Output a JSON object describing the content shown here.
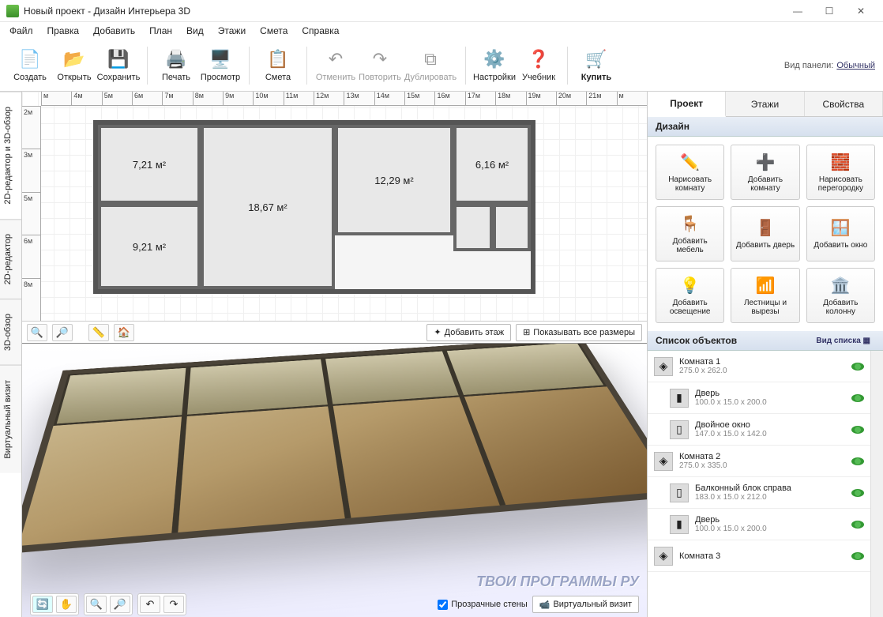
{
  "window": {
    "title": "Новый проект - Дизайн Интерьера 3D"
  },
  "menu": [
    "Файл",
    "Правка",
    "Добавить",
    "План",
    "Вид",
    "Этажи",
    "Смета",
    "Справка"
  ],
  "toolbar": {
    "create": "Создать",
    "open": "Открыть",
    "save": "Сохранить",
    "print": "Печать",
    "preview": "Просмотр",
    "estimate": "Смета",
    "undo": "Отменить",
    "redo": "Повторить",
    "duplicate": "Дублировать",
    "settings": "Настройки",
    "tutorial": "Учебник",
    "buy": "Купить",
    "panel_label": "Вид панели:",
    "panel_mode": "Обычный"
  },
  "sidetabs": {
    "t1": "2D-редактор и 3D-обзор",
    "t2": "2D-редактор",
    "t3": "3D-обзор",
    "t4": "Виртуальный визит"
  },
  "ruler_h": [
    "м",
    "4м",
    "5м",
    "6м",
    "7м",
    "8м",
    "9м",
    "10м",
    "11м",
    "12м",
    "13м",
    "14м",
    "15м",
    "16м",
    "17м",
    "18м",
    "19м",
    "20м",
    "21м",
    "м"
  ],
  "ruler_v": [
    "2м",
    "3м",
    "5м",
    "6м",
    "8м"
  ],
  "rooms": {
    "r1": "7,21 м²",
    "r2": "18,67 м²",
    "r3": "12,29 м²",
    "r4": "6,16 м²",
    "r5": "9,21 м²"
  },
  "canvas2d": {
    "add_floor": "Добавить этаж",
    "show_dims": "Показывать все размеры"
  },
  "canvas3d": {
    "transparent": "Прозрачные стены",
    "camera": "Виртуальный визит"
  },
  "rtabs": {
    "project": "Проект",
    "floors": "Этажи",
    "props": "Свойства"
  },
  "design": {
    "header": "Дизайн",
    "draw_room": "Нарисовать комнату",
    "add_room": "Добавить комнату",
    "draw_partition": "Нарисовать перегородку",
    "add_furniture": "Добавить мебель",
    "add_door": "Добавить дверь",
    "add_window": "Добавить окно",
    "add_light": "Добавить освещение",
    "stairs": "Лестницы и вырезы",
    "add_column": "Добавить колонну"
  },
  "objects": {
    "header": "Список объектов",
    "view_label": "Вид списка",
    "items": [
      {
        "name": "Комната 1",
        "dims": "275.0 x 262.0",
        "child": false,
        "icon": "◈"
      },
      {
        "name": "Дверь",
        "dims": "100.0 x 15.0 x 200.0",
        "child": true,
        "icon": "▮"
      },
      {
        "name": "Двойное окно",
        "dims": "147.0 x 15.0 x 142.0",
        "child": true,
        "icon": "▯"
      },
      {
        "name": "Комната 2",
        "dims": "275.0 x 335.0",
        "child": false,
        "icon": "◈"
      },
      {
        "name": "Балконный блок справа",
        "dims": "183.0 x 15.0 x 212.0",
        "child": true,
        "icon": "▯"
      },
      {
        "name": "Дверь",
        "dims": "100.0 x 15.0 x 200.0",
        "child": true,
        "icon": "▮"
      },
      {
        "name": "Комната 3",
        "dims": "",
        "child": false,
        "icon": "◈"
      }
    ]
  },
  "watermark": "ТВОИ ПРОГРАММЫ РУ"
}
